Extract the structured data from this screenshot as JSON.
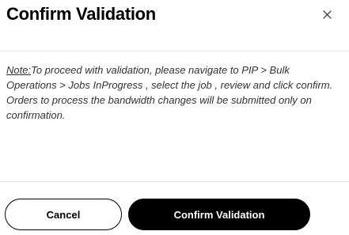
{
  "modal": {
    "title": "Confirm Validation",
    "close_icon": "close-icon",
    "note_label": "Note:",
    "message": "To proceed with validation, please navigate to PIP > Bulk Operations > Jobs InProgress , select the job , review and click confirm. Orders to process the bandwidth changes will be submitted only on confirmation."
  },
  "actions": {
    "cancel_label": "Cancel",
    "confirm_label": "Confirm Validation"
  },
  "colors": {
    "primary_button": "#000000",
    "primary_button_text": "#ffffff",
    "body_text": "#333333",
    "divider": "#e6e6e6"
  }
}
